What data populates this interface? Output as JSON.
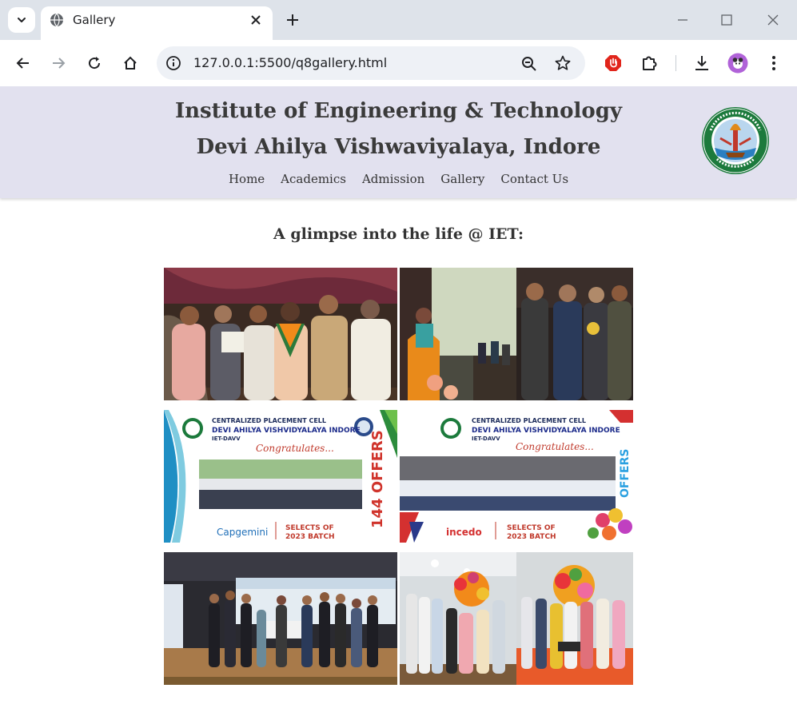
{
  "browser": {
    "tab_title": "Gallery",
    "url": "127.0.0.1:5500/q8gallery.html",
    "icons": [
      "tab-list-icon",
      "globe-icon",
      "close-icon",
      "plus-icon",
      "minimize-icon",
      "maximize-icon",
      "window-close-icon",
      "back-icon",
      "forward-icon",
      "reload-icon",
      "home-icon",
      "info-icon",
      "zoom-icon",
      "star-icon",
      "adblock-icon",
      "extensions-icon",
      "download-icon",
      "profile-icon",
      "menu-icon"
    ]
  },
  "header": {
    "title_line1": "Institute of Engineering & Technology",
    "title_line2": "Devi Ahilya Vishwaviyalaya, Indore",
    "nav": [
      "Home",
      "Academics",
      "Admission",
      "Gallery",
      "Contact Us"
    ],
    "colors": {
      "background": "#e2e1ef",
      "text": "#3a3a3a"
    }
  },
  "gallery": {
    "heading": "A glimpse into the life @ IET:",
    "photos": [
      {
        "subject": "award-ceremony-stage"
      },
      {
        "subject": "seminar-and-felicitation"
      },
      {
        "subject": "placement-poster-capgemini",
        "lines": [
          "CENTRALIZED PLACEMENT CELL",
          "DEVI AHILYA VISHVIDYALAYA INDORE",
          "IET-DAVV",
          "Congratulates...",
          "144 OFFERS",
          "Capgemini",
          "SELECTS OF",
          "2023 BATCH"
        ]
      },
      {
        "subject": "placement-poster-incedo",
        "lines": [
          "CENTRALIZED PLACEMENT CELL",
          "DEVI AHILYA VISHVIDYALAYA INDORE",
          "IET-DAVV",
          "Congratulates...",
          "OFFERS",
          "incedo",
          "SELECTS OF",
          "2023 BATCH"
        ]
      },
      {
        "subject": "hackathon-winners-cheque"
      },
      {
        "subject": "cultural-event-celebration"
      }
    ]
  }
}
